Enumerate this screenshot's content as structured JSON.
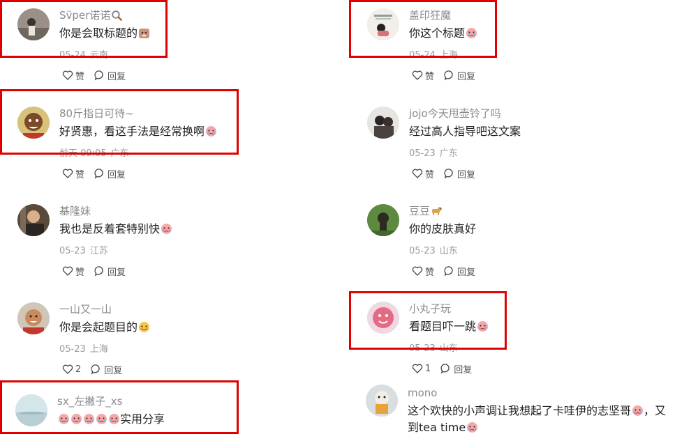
{
  "comments": [
    {
      "name": "Sv̈per诺诺",
      "text": "你是会取标题的",
      "date": "05-24",
      "location": "云南",
      "likes": "赞",
      "reply": "回复"
    },
    {
      "name": "盖印狂魔",
      "text": "你这个标题",
      "date": "05-24",
      "location": "上海",
      "likes": "赞",
      "reply": "回复"
    },
    {
      "name": "80斤指日可待~",
      "text": "好贤惠，看这手法是经常换啊",
      "date": "前天 09:05",
      "location": "广东",
      "likes": "赞",
      "reply": "回复"
    },
    {
      "name": "jojo今天甩壶铃了吗",
      "text": "经过高人指导吧这文案",
      "date": "05-23",
      "location": "广东",
      "likes": "赞",
      "reply": "回复"
    },
    {
      "name": "基隆妹",
      "text": "我也是反着套特别快",
      "date": "05-23",
      "location": "江苏",
      "likes": "赞",
      "reply": "回复"
    },
    {
      "name": "豆豆",
      "text": "你的皮肤真好",
      "date": "05-23",
      "location": "山东",
      "likes": "赞",
      "reply": "回复"
    },
    {
      "name": "一山又一山",
      "text": "你是会起题目的",
      "date": "05-23",
      "location": "上海",
      "likes": "2",
      "reply": "回复"
    },
    {
      "name": "小丸子玩",
      "text": "看题目吓一跳",
      "date": "05-23",
      "location": "山东",
      "likes": "1",
      "reply": "回复"
    },
    {
      "name": "sx_左撇子_xs",
      "text": "实用分享"
    },
    {
      "name": "mono",
      "text_line1": "这个欢快的小声调让我想起了卡哇伊的志坚哥",
      "text_line1_tail": "，又",
      "text_line2": "到tea time"
    }
  ],
  "icons": {
    "like": "heart-outline-icon",
    "reply": "speech-bubble-icon"
  },
  "colors": {
    "highlight": "#e00000",
    "name": "#8a8a8a",
    "meta": "#9a9a9a"
  }
}
